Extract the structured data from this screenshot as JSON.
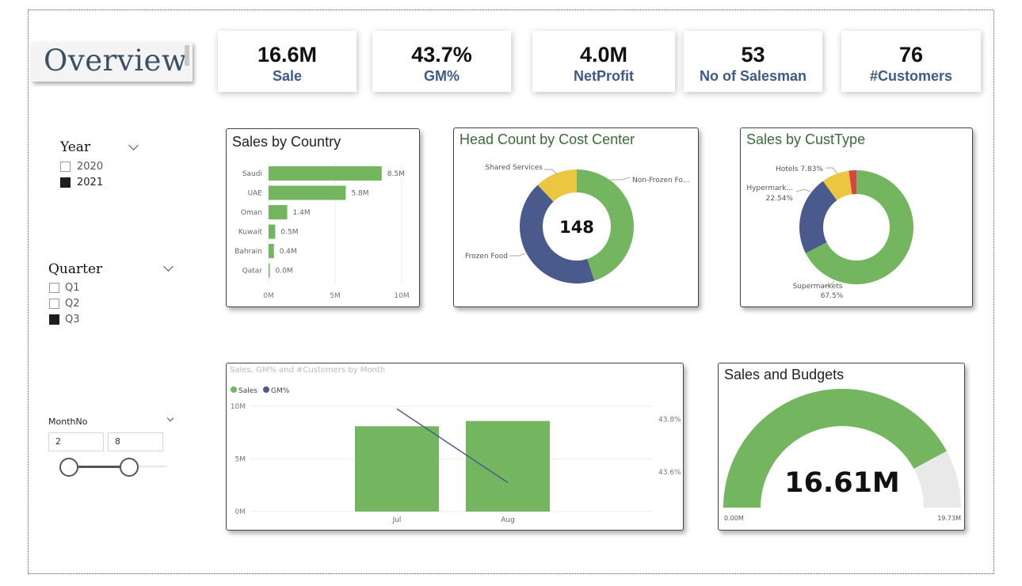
{
  "title": "Overview",
  "kpis": [
    {
      "value": "16.6M",
      "label": "Sale"
    },
    {
      "value": "43.7%",
      "label": "GM%"
    },
    {
      "value": "4.0M",
      "label": "NetProfit"
    },
    {
      "value": "53",
      "label": "No of Salesman"
    },
    {
      "value": "76",
      "label": "#Customers"
    }
  ],
  "slicers": {
    "year": {
      "header": "Year",
      "options": [
        {
          "label": "2020",
          "checked": false
        },
        {
          "label": "2021",
          "checked": true
        }
      ]
    },
    "quarter": {
      "header": "Quarter",
      "options": [
        {
          "label": "Q1",
          "checked": false
        },
        {
          "label": "Q2",
          "checked": false
        },
        {
          "label": "Q3",
          "checked": true
        }
      ]
    },
    "month": {
      "header": "MonthNo",
      "min_value": "2",
      "max_value": "8"
    }
  },
  "colors": {
    "green": "#74b65f",
    "navy": "#4a5a8c",
    "yellow": "#ebc640",
    "red": "#d64541",
    "title_green": "#3a6b35",
    "kpi_label": "#3f5a8a"
  },
  "chart_data": [
    {
      "id": "sales_by_country",
      "type": "bar",
      "orientation": "horizontal",
      "title": "Sales by Country",
      "categories": [
        "Saudi",
        "UAE",
        "Oman",
        "Kuwait",
        "Bahrain",
        "Qatar"
      ],
      "values": [
        8.5,
        5.8,
        1.4,
        0.5,
        0.4,
        0.0
      ],
      "data_labels": [
        "8.5M",
        "5.8M",
        "1.4M",
        "0.5M",
        "0.4M",
        "0.0M"
      ],
      "x_ticks": [
        "0M",
        "5M",
        "10M"
      ],
      "xlim": [
        0,
        10
      ],
      "grid": true
    },
    {
      "id": "head_count_by_cost_center",
      "type": "pie",
      "title": "Head Count by Cost Center",
      "center_label": "148",
      "slices": [
        {
          "label": "Non-Frozen Fo...",
          "value": 0.45,
          "color": "#74b65f"
        },
        {
          "label": "Frozen Food",
          "value": 0.43,
          "color": "#4a5a8c"
        },
        {
          "label": "Shared Services",
          "value": 0.12,
          "color": "#ebc640"
        }
      ]
    },
    {
      "id": "sales_by_custtype",
      "type": "pie",
      "title": "Sales by CustType",
      "slices": [
        {
          "label": "Supermarkets",
          "pct_label": "67.5%",
          "value": 67.5,
          "color": "#74b65f"
        },
        {
          "label": "Hypermark...",
          "pct_label": "22.54%",
          "value": 22.54,
          "color": "#4a5a8c"
        },
        {
          "label": "Hotels",
          "pct_label": "7.83%",
          "value": 7.83,
          "color": "#ebc640"
        },
        {
          "label": "",
          "pct_label": "",
          "value": 2.13,
          "color": "#d64541"
        }
      ]
    },
    {
      "id": "sales_gm_customers_by_month",
      "type": "bar",
      "title": "Sales, GM% and #Customers by Month",
      "categories": [
        "Jul",
        "Aug"
      ],
      "series": [
        {
          "name": "Sales",
          "type": "bar",
          "values": [
            8.1,
            8.6
          ],
          "color": "#74b65f"
        },
        {
          "name": "GM%",
          "type": "line",
          "values": [
            43.84,
            43.56
          ],
          "color": "#4a5a8c"
        }
      ],
      "y_ticks": [
        "0M",
        "5M",
        "10M"
      ],
      "ylim": [
        0,
        10
      ],
      "y2_ticks": [
        "43.6%",
        "43.8%"
      ],
      "y2lim": [
        43.45,
        43.85
      ],
      "legend": "top-left"
    },
    {
      "id": "sales_and_budgets",
      "type": "gauge",
      "title": "Sales and Budgets",
      "value": 16.61,
      "value_label": "16.61M",
      "min_label": "0.00M",
      "max_label": "19.73M",
      "min": 0,
      "max": 19.73
    }
  ]
}
